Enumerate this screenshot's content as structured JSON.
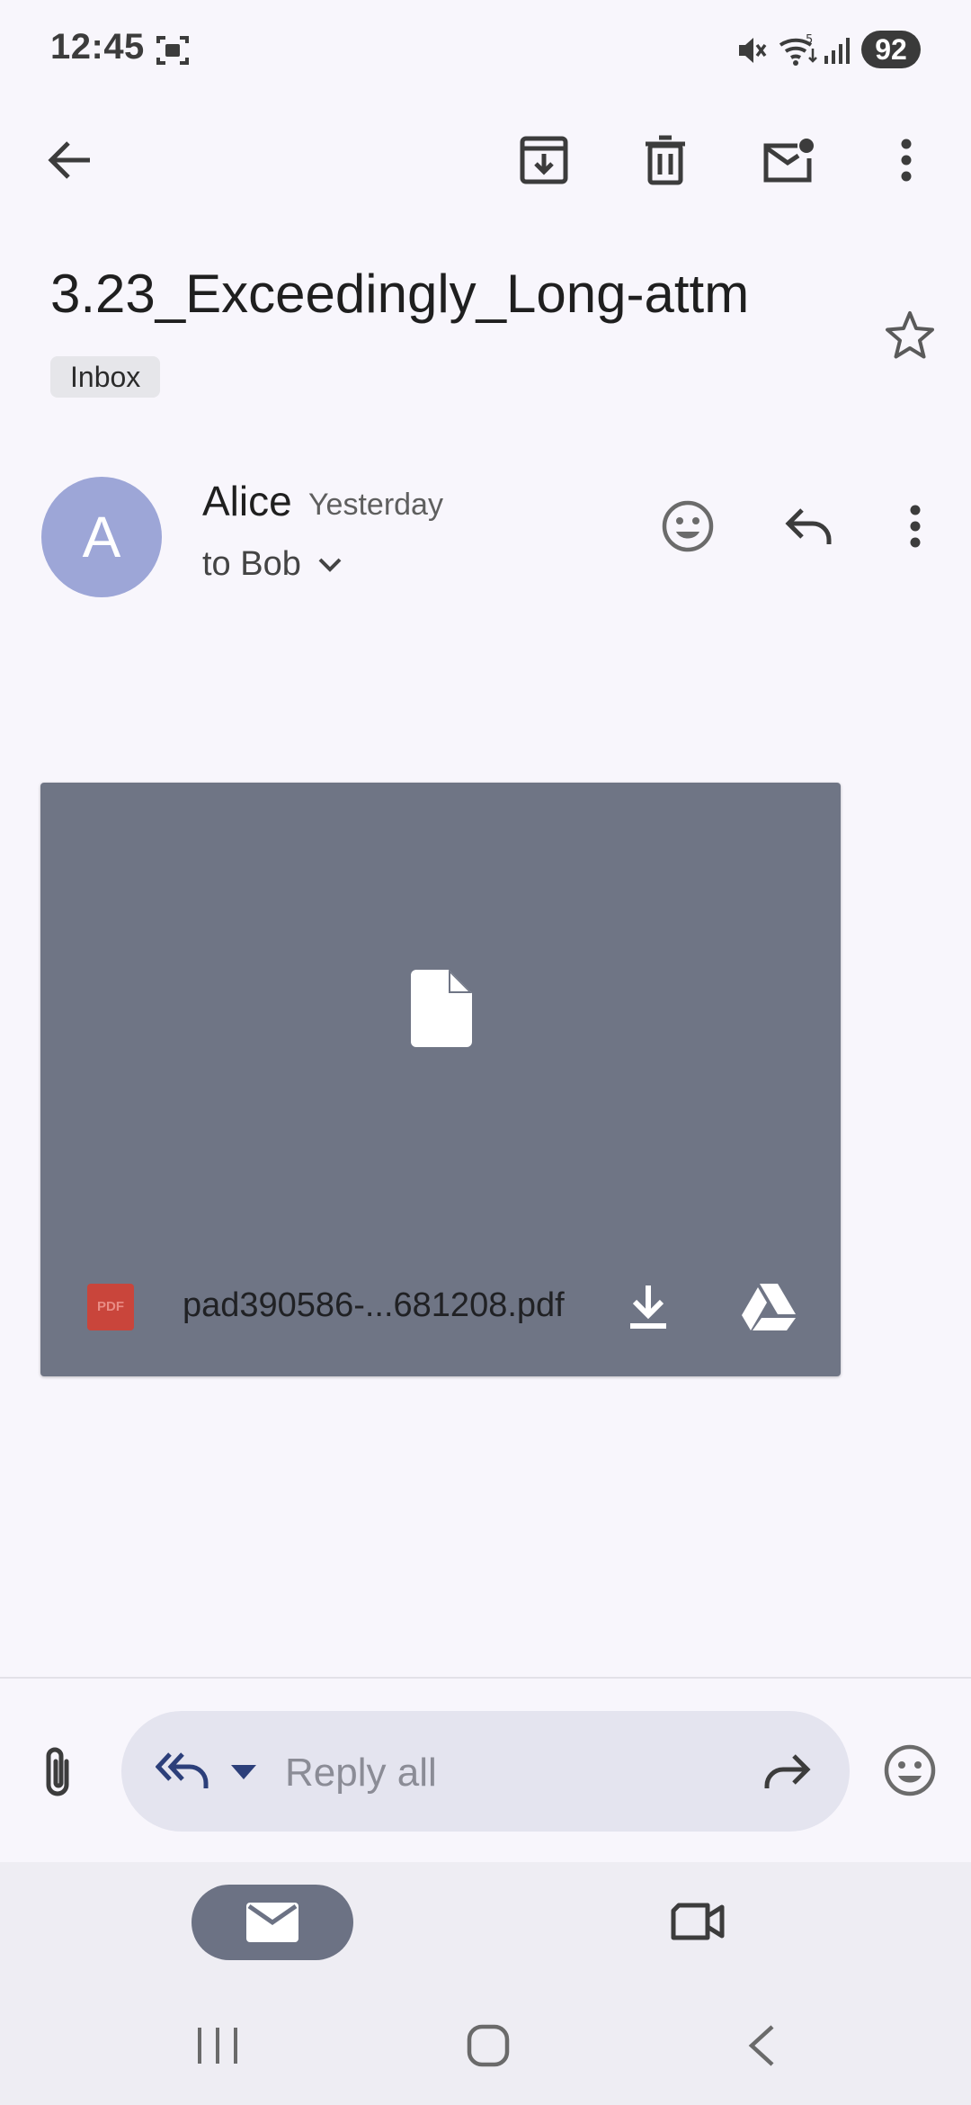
{
  "status_bar": {
    "time": "12:45",
    "battery": "92",
    "icons": [
      "screenshot-icon",
      "mute-icon",
      "wifi-icon",
      "signal-icon"
    ]
  },
  "toolbar": {
    "icons": [
      "back-arrow-icon",
      "archive-icon",
      "delete-icon",
      "mark-unread-icon",
      "more-vert-icon"
    ]
  },
  "message": {
    "subject": "3.23_Exceedingly_Long-attm",
    "label": "Inbox",
    "sender": {
      "initial": "A",
      "avatar_color": "#9da6d7",
      "name": "Alice",
      "time": "Yesterday",
      "recipient": "to Bob"
    }
  },
  "attachment": {
    "badge": "PDF",
    "file_name": "pad390586-...681208.pdf",
    "card_color": "#6f7585",
    "actions": [
      "download-icon",
      "drive-icon"
    ]
  },
  "compose": {
    "placeholder": "Reply all",
    "icons": [
      "attach-icon",
      "reply-all-icon",
      "forward-icon",
      "emoji-icon"
    ]
  },
  "bottom_nav": {
    "tabs": [
      "mail-icon",
      "video-icon"
    ],
    "system": [
      "recents-icon",
      "home-icon",
      "system-back-icon"
    ]
  }
}
